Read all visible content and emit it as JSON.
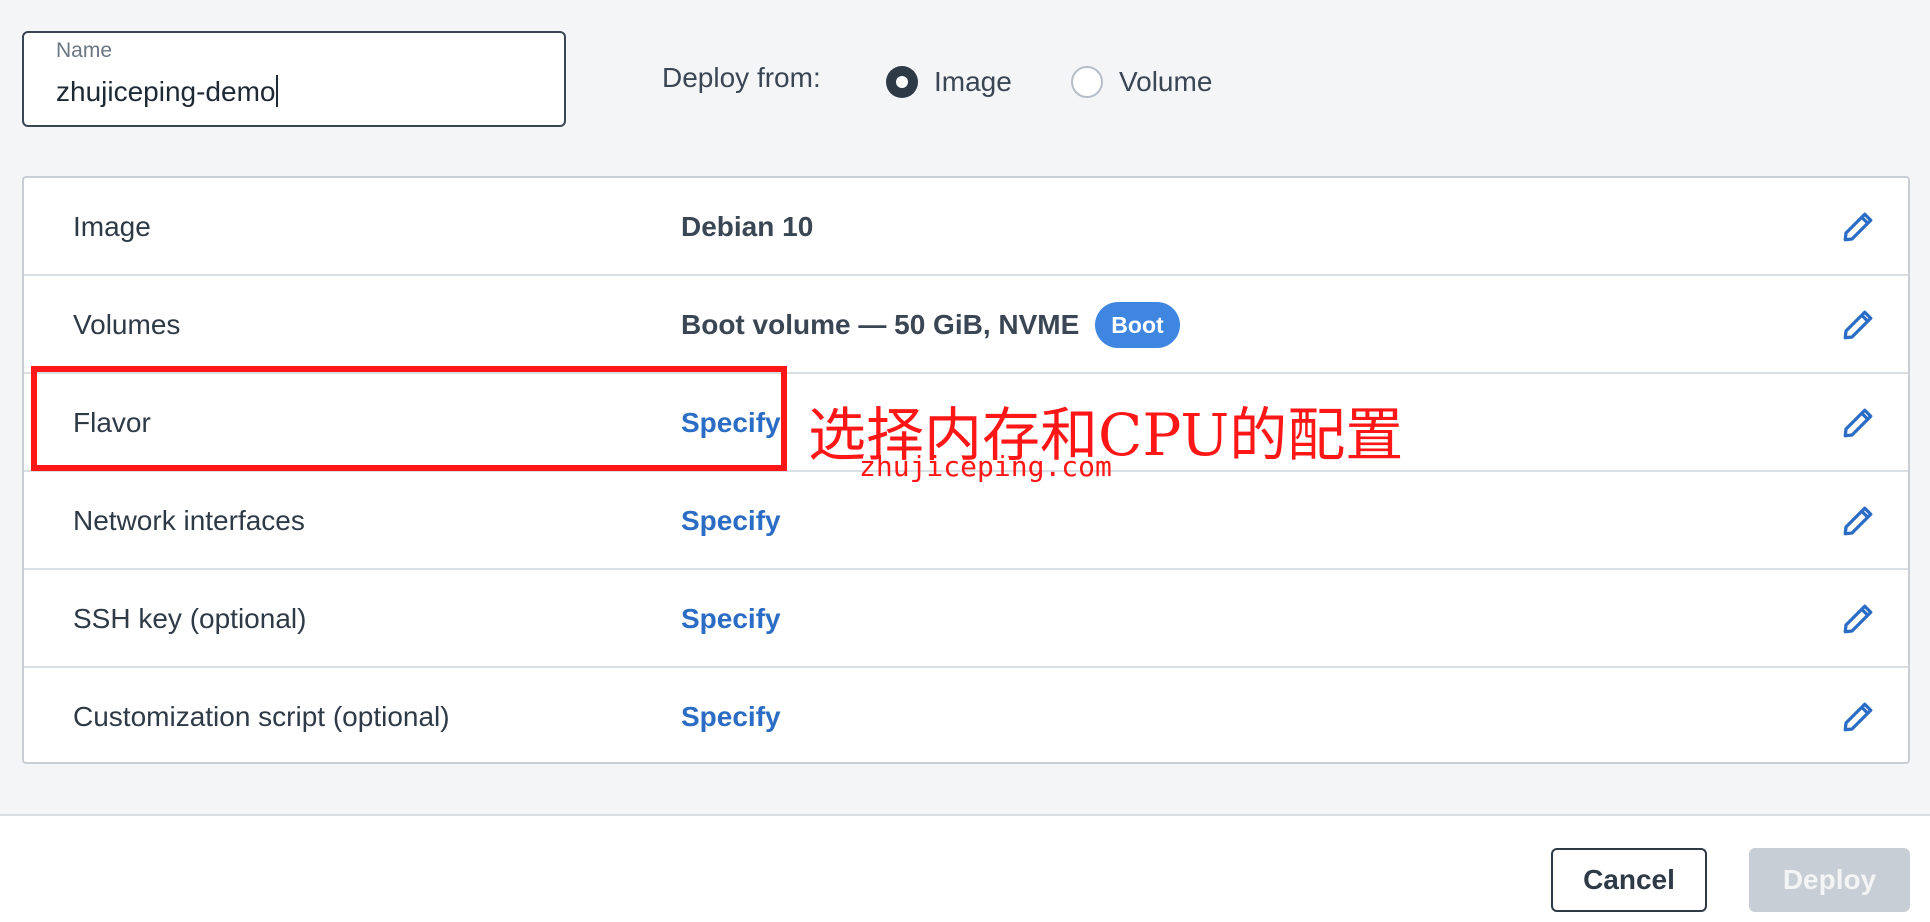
{
  "name_field": {
    "label": "Name",
    "value": "zhujiceping-demo"
  },
  "deploy_from": {
    "label": "Deploy from:",
    "options": [
      {
        "label": "Image",
        "checked": true
      },
      {
        "label": "Volume",
        "checked": false
      }
    ]
  },
  "config_rows": [
    {
      "label": "Image",
      "value": "Debian 10",
      "value_type": "text",
      "action_icon": "pencil-icon"
    },
    {
      "label": "Volumes",
      "value": "Boot volume  — 50 GiB, NVME",
      "badge": "Boot",
      "value_type": "text",
      "action_icon": "pencil-icon"
    },
    {
      "label": "Flavor",
      "value": "Specify",
      "value_type": "link",
      "action_icon": "pencil-icon"
    },
    {
      "label": "Network interfaces",
      "value": "Specify",
      "value_type": "link",
      "action_icon": "pencil-icon"
    },
    {
      "label": "SSH key (optional)",
      "value": "Specify",
      "value_type": "link",
      "action_icon": "pencil-icon"
    },
    {
      "label": "Customization script (optional)",
      "value": "Specify",
      "value_type": "link",
      "action_icon": "pencil-icon"
    }
  ],
  "annotation": {
    "text": "选择内存和CPU的配置",
    "watermark": "zhujiceping.com",
    "color": "#ff1616"
  },
  "footer": {
    "cancel_label": "Cancel",
    "deploy_label": "Deploy",
    "deploy_enabled": false
  },
  "colors": {
    "link": "#2b6cc4",
    "badge": "#3f86e0",
    "text": "#2f3a47"
  }
}
